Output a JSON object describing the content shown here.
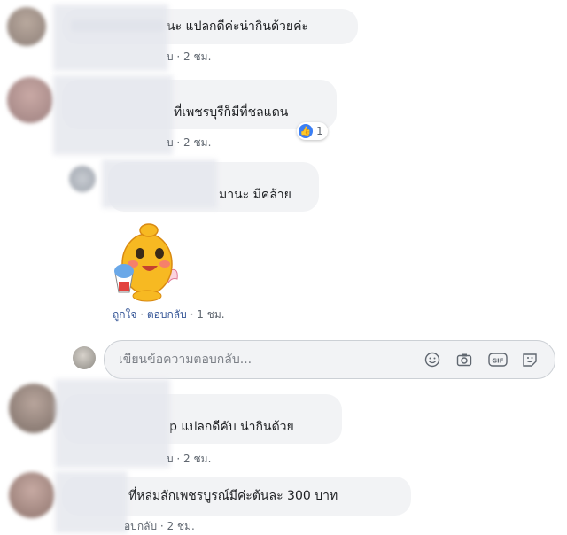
{
  "comments": [
    {
      "text": "นะ แปลกดีค่ะน่ากินด้วยค่ะ",
      "meta_tail": "บ · 2 ชม."
    },
    {
      "text": "ที่เพชรบุรีก็มีที่ชลแดน",
      "meta_tail": "บ · 2 ชม.",
      "reaction_count": "1"
    },
    {
      "text": "มานะ มีคล้าย"
    },
    {
      "text": "p แปลกดีคับ น่ากินด้วย",
      "meta_tail": "บ · 2 ชม."
    },
    {
      "text": "ที่หล่มสักเพชรบูรณ์มีค่ะต้นละ 300 บาท",
      "meta_tail": "อบกลับ · 2 ชม."
    }
  ],
  "reply_meta": {
    "like": "ถูกใจ",
    "reply": "ตอบกลับ",
    "time": "1 ชม."
  },
  "reply_box": {
    "placeholder": "เขียนข้อความตอบกลับ..."
  },
  "icons": [
    "smiley-icon",
    "camera-icon",
    "gif-icon",
    "sticker-icon",
    "like-icon"
  ],
  "colors": {
    "bubble": "#f2f3f5",
    "link": "#385898",
    "meta": "#606770",
    "like": "#3b7ff5"
  }
}
